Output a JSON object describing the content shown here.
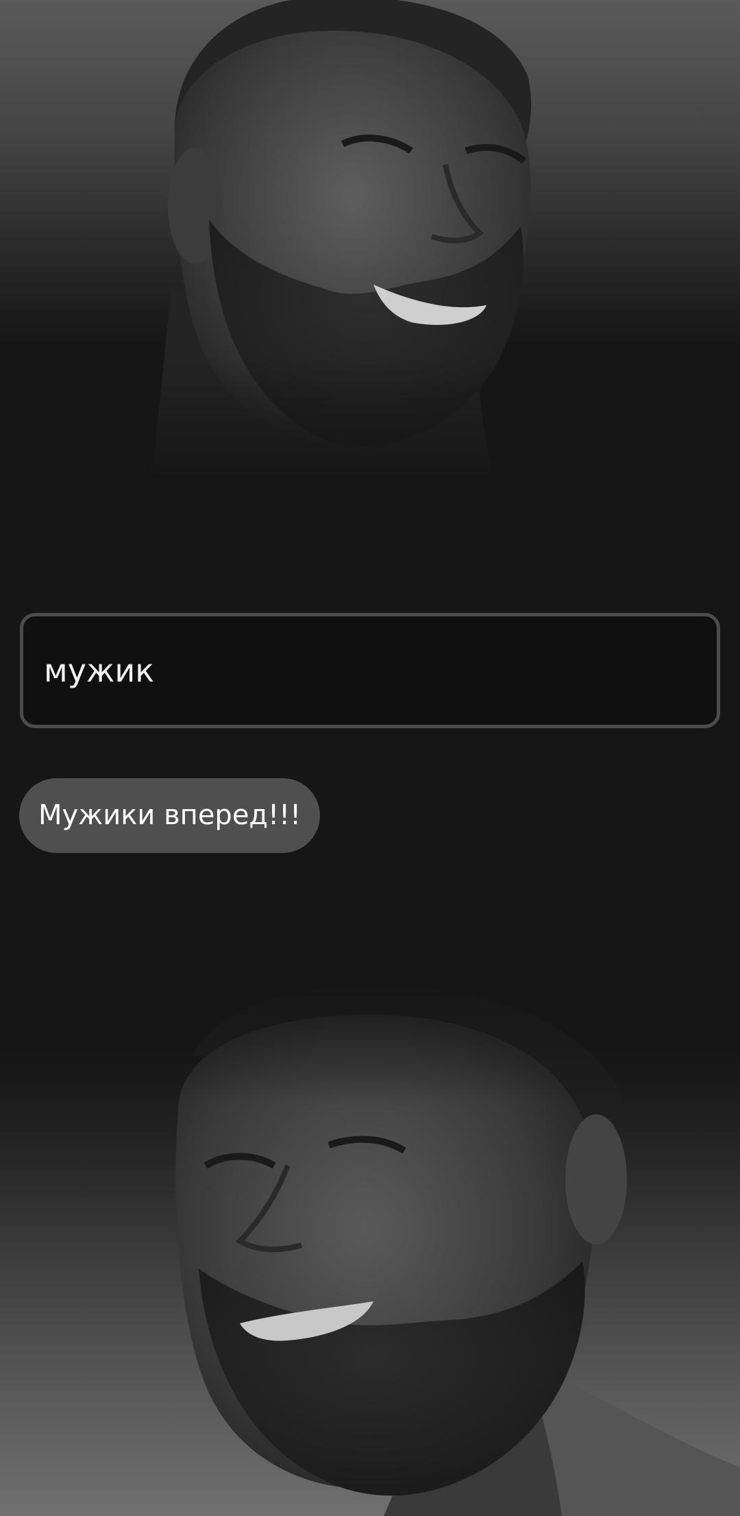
{
  "search": {
    "value": "мужик",
    "placeholder": ""
  },
  "suggestions": [
    {
      "label": "Мужики вперед!!!"
    }
  ],
  "images": {
    "top": "portrait-photo",
    "bottom": "portrait-photo"
  },
  "colors": {
    "background": "#161616",
    "input_border": "#4c4c4c",
    "chip_background": "#4f4f4f",
    "text": "#ffffff"
  }
}
